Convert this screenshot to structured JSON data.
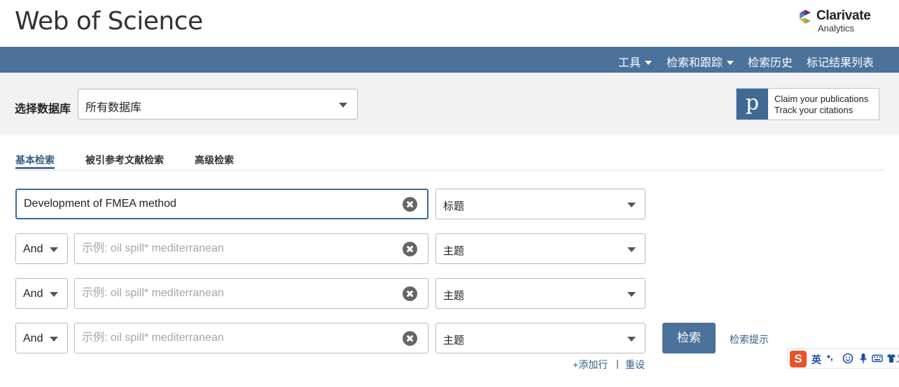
{
  "header": {
    "app_title": "Web of Science",
    "brand_name": "Clarivate",
    "brand_sub": "Analytics",
    "brand_colors": [
      "#5b2c83",
      "#27a3c4",
      "#e7a633",
      "#7ab648"
    ]
  },
  "nav": {
    "items": [
      {
        "label": "工具",
        "has_caret": true
      },
      {
        "label": "检索和跟踪",
        "has_caret": true
      },
      {
        "label": "检索历史",
        "has_caret": false
      },
      {
        "label": "标记结果列表",
        "has_caret": false
      }
    ]
  },
  "database": {
    "label": "选择数据库",
    "selected": "所有数据库"
  },
  "promo": {
    "logo_letter": "p",
    "line1": "Claim your publications",
    "line2": "Track your citations"
  },
  "tabs": [
    {
      "label": "基本检索",
      "active": true
    },
    {
      "label": "被引参考文献检索",
      "active": false
    },
    {
      "label": "高级检索",
      "active": false
    }
  ],
  "search_rows": [
    {
      "operator": null,
      "value": "Development of FMEA method",
      "placeholder": "",
      "field": "标题"
    },
    {
      "operator": "And",
      "value": "",
      "placeholder": "示例: oil spill* mediterranean",
      "field": "主题"
    },
    {
      "operator": "And",
      "value": "",
      "placeholder": "示例: oil spill* mediterranean",
      "field": "主题"
    },
    {
      "operator": "And",
      "value": "",
      "placeholder": "示例: oil spill* mediterranean",
      "field": "主题"
    }
  ],
  "actions": {
    "search_label": "检索",
    "tips_label": "检索提示",
    "add_row_label": "+添加行",
    "separator": "|",
    "reset_label": "重设"
  },
  "ime": {
    "logo": "S",
    "lang": "英",
    "punct": "•,",
    "icons": [
      "smiley-icon",
      "microphone-icon",
      "keyboard-icon",
      "shirt-icon",
      "user-icon"
    ]
  },
  "colors": {
    "nav_bg": "#4a729b",
    "accent": "#355f87",
    "band_bg": "#f2f2f2"
  }
}
